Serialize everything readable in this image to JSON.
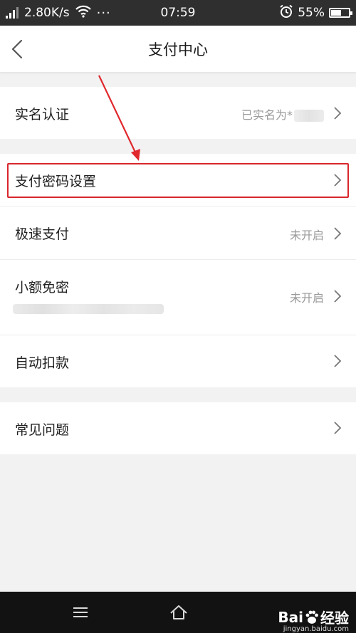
{
  "status_bar": {
    "network_speed": "2.80K/s",
    "dots": "···",
    "time": "07:59",
    "battery": "55%",
    "battery_level": 0.55
  },
  "nav": {
    "title": "支付中心",
    "back_icon": "chevron-left-icon"
  },
  "rows": {
    "real_name": {
      "label": "实名认证",
      "value": "已实名为*"
    },
    "pay_password": {
      "label": "支付密码设置"
    },
    "fast_pay": {
      "label": "极速支付",
      "value": "未开启"
    },
    "small_free": {
      "label": "小额免密",
      "value": "未开启"
    },
    "auto_deduct": {
      "label": "自动扣款"
    },
    "faq": {
      "label": "常见问题"
    }
  },
  "annotation": {
    "highlight_color": "#d9262b"
  },
  "watermark": {
    "brand_prefix": "Bai",
    "brand_suffix": "经验",
    "url": "jingyan.baidu.com"
  },
  "colors": {
    "background": "#f2f2f2",
    "status_bar": "#2f2f2f",
    "value_text": "#9a9a9a"
  }
}
